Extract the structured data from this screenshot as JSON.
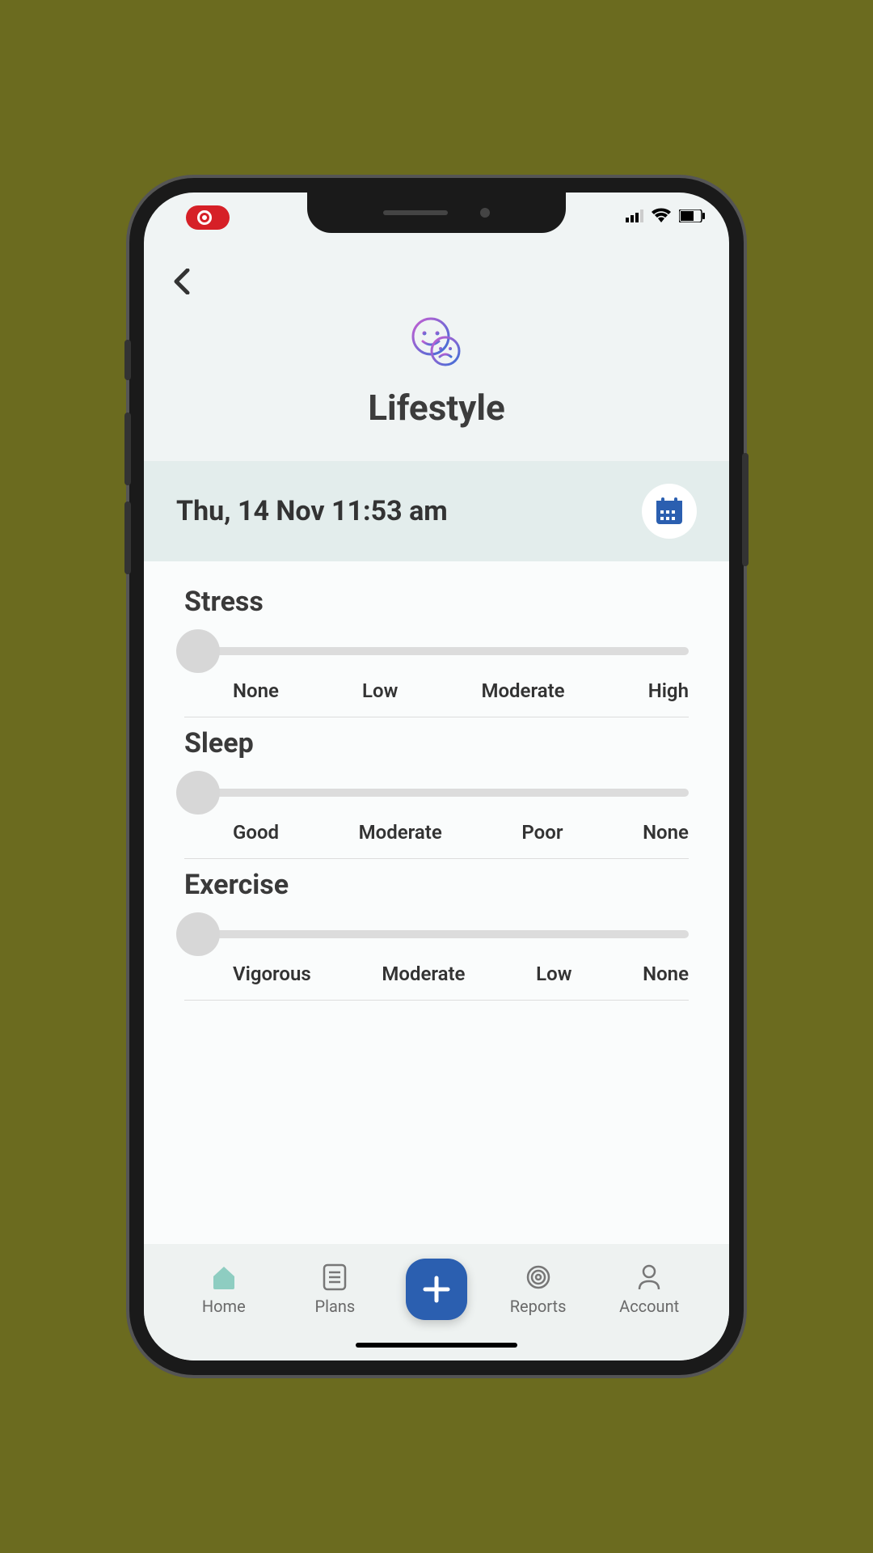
{
  "header": {
    "title": "Lifestyle"
  },
  "datetime": {
    "display": "Thu, 14 Nov   11:53 am"
  },
  "sliders": [
    {
      "label": "Stress",
      "marks": [
        "None",
        "Low",
        "Moderate",
        "High"
      ]
    },
    {
      "label": "Sleep",
      "marks": [
        "Good",
        "Moderate",
        "Poor",
        "None"
      ]
    },
    {
      "label": "Exercise",
      "marks": [
        "Vigorous",
        "Moderate",
        "Low",
        "None"
      ]
    }
  ],
  "nav": {
    "items": [
      {
        "label": "Home",
        "icon": "home"
      },
      {
        "label": "Plans",
        "icon": "plans"
      },
      {
        "label": "Reports",
        "icon": "reports"
      },
      {
        "label": "Account",
        "icon": "account"
      }
    ]
  }
}
